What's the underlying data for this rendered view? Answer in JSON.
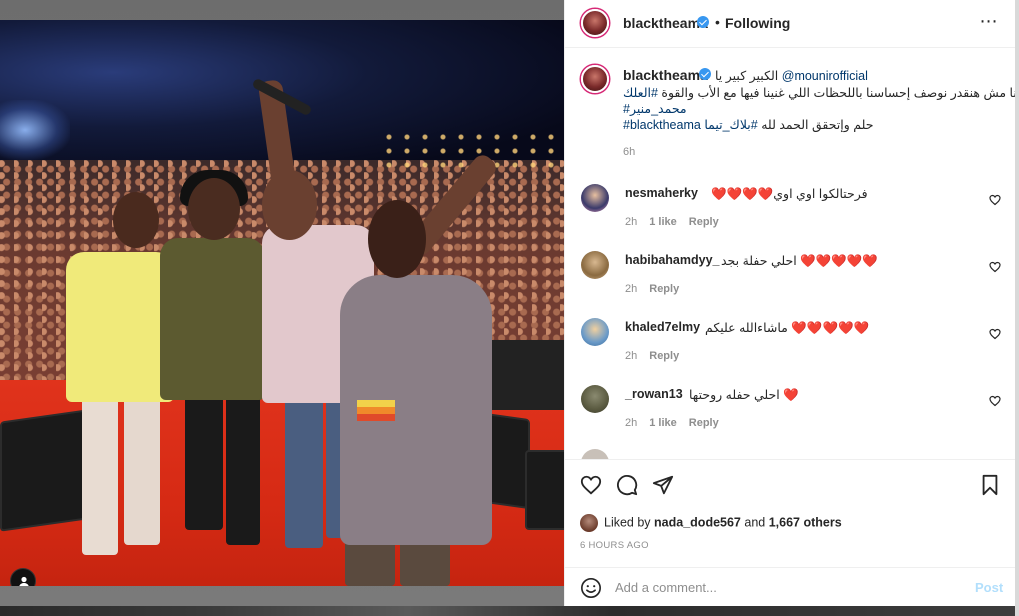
{
  "post": {
    "author": "blacktheama",
    "follow_status": "Following",
    "separator": "•",
    "more_label": "⋯"
  },
  "caption": {
    "author": "blacktheama",
    "line1_text": "الكبير كبير يا",
    "line1_mention": "@mounirofficial",
    "line2_text": "مهما قلنا مش هنقدر نوصف إحساسنا باللحظات اللي غنينا فيها مع الأب والقوة",
    "line2_hashtag": "#العلك",
    "line3_hashtag": "#محمد_منير",
    "line4_hashtag1": "#blacktheama",
    "line4_text": "حلم وإتحقق الحمد لله",
    "line4_hashtag2": "#بلاك_تيما",
    "time": "6h"
  },
  "comments": [
    {
      "user": "nesmaherky",
      "text": "❤️❤️❤️❤️فرحتالكوا اوي اوي",
      "time": "2h",
      "likes": "1 like",
      "reply": "Reply"
    },
    {
      "user": "habibahamdyy_",
      "text": "احلي حفلة بجد ❤️❤️❤️❤️❤️",
      "time": "2h",
      "likes": "",
      "reply": "Reply"
    },
    {
      "user": "khaled7elmy",
      "text": "ماشاءالله عليكم ❤️❤️❤️❤️❤️",
      "time": "2h",
      "likes": "",
      "reply": "Reply"
    },
    {
      "user": "_rowan13",
      "text": "احلي حفله روحتها ❤️",
      "time": "2h",
      "likes": "1 like",
      "reply": "Reply"
    }
  ],
  "likes": {
    "prefix": "Liked by",
    "user": "nada_dode567",
    "middle": "and",
    "count": "1,667 others"
  },
  "posted": "6 HOURS AGO",
  "composer": {
    "placeholder": "Add a comment...",
    "post_label": "Post"
  },
  "icons": {
    "like": "heart-icon",
    "comment": "comment-icon",
    "share": "send-icon",
    "save": "bookmark-icon",
    "emoji": "emoji-icon",
    "tagged": "person-tag-icon",
    "more": "more-horizontal-icon",
    "verified": "verified-badge-icon"
  },
  "colors": {
    "link": "#00376b",
    "muted": "#8e8e8e",
    "verified": "#3897f0",
    "post_disabled": "#b2dffc",
    "stage": "#e0331c"
  }
}
